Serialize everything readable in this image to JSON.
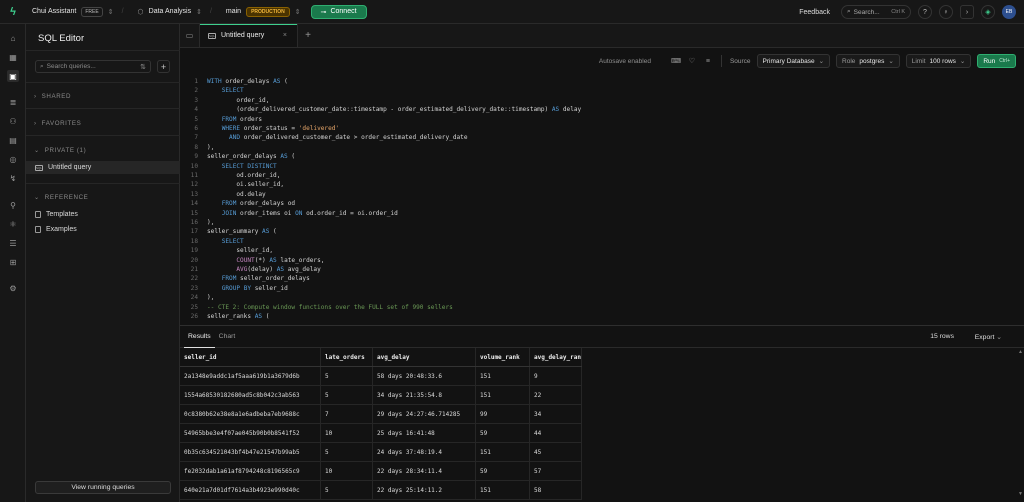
{
  "topbar": {
    "org_name": "Chui Assistant",
    "org_plan": "FREE",
    "project_name": "Data Analysis",
    "branch_name": "main",
    "branch_badge": "PRODUCTION",
    "connect_label": "Connect",
    "feedback_label": "Feedback",
    "search_label": "Search...",
    "search_shortcut": "Ctrl K",
    "avatar_initials": "EB"
  },
  "sidebar": {
    "title": "SQL Editor",
    "search_placeholder": "Search queries...",
    "sections": {
      "shared": "SHARED",
      "favorites": "FAVORITES",
      "private": "PRIVATE (1)",
      "reference": "REFERENCE"
    },
    "private_items": [
      "Untitled query"
    ],
    "reference_items": [
      "Templates",
      "Examples"
    ],
    "view_running_label": "View running queries"
  },
  "tabs": {
    "active_tab_label": "Untitled query"
  },
  "toolbar": {
    "autosave": "Autosave enabled",
    "source_label": "Source",
    "source_value": "Primary Database",
    "role_label": "Role",
    "role_value": "postgres",
    "limit_label": "Limit",
    "limit_value": "100 rows",
    "run_label": "Run",
    "run_shortcut": "Ctrl+"
  },
  "editor": {
    "lines": [
      "WITH order_delays AS (",
      "    SELECT",
      "        order_id,",
      "        (order_delivered_customer_date::timestamp - order_estimated_delivery_date::timestamp) AS delay",
      "    FROM orders",
      "    WHERE order_status = 'delivered'",
      "      AND order_delivered_customer_date > order_estimated_delivery_date",
      "),",
      "seller_order_delays AS (",
      "    SELECT DISTINCT",
      "        od.order_id,",
      "        oi.seller_id,",
      "        od.delay",
      "    FROM order_delays od",
      "    JOIN order_items oi ON od.order_id = oi.order_id",
      "),",
      "seller_summary AS (",
      "    SELECT",
      "        seller_id,",
      "        COUNT(*) AS late_orders,",
      "        AVG(delay) AS avg_delay",
      "    FROM seller_order_delays",
      "    GROUP BY seller_id",
      "),",
      "-- CTE 2: Compute window functions over the FULL set of 990 sellers",
      "seller_ranks AS ("
    ]
  },
  "results": {
    "tab_results": "Results",
    "tab_chart": "Chart",
    "row_count": "15 rows",
    "export_label": "Export",
    "columns": [
      "seller_id",
      "late_orders",
      "avg_delay",
      "volume_rank",
      "avg_delay_ran"
    ],
    "rows": [
      [
        "2a1348e9addc1af5aaa619b1a3679d6b",
        "5",
        "58 days 20:48:33.6",
        "151",
        "9"
      ],
      [
        "1554a68530182680ad5c8b042c3ab563",
        "5",
        "34 days 21:35:54.8",
        "151",
        "22"
      ],
      [
        "0c8380b62e38e8a1e6adbeba7eb9688c",
        "7",
        "29 days 24:27:46.714285",
        "99",
        "34"
      ],
      [
        "54965bbe3e4f07ae045b90b0b8541f52",
        "10",
        "25 days 16:41:48",
        "59",
        "44"
      ],
      [
        "0b35c634521043bf4b47e21547b99ab5",
        "5",
        "24 days 37:48:19.4",
        "151",
        "45"
      ],
      [
        "fe2032dab1a61af8794248c8196565c9",
        "10",
        "22 days 28:34:11.4",
        "59",
        "57"
      ],
      [
        "640e21a7d01df7614a3b4923e990d40c",
        "5",
        "22 days 25:14:11.2",
        "151",
        "58"
      ]
    ]
  }
}
